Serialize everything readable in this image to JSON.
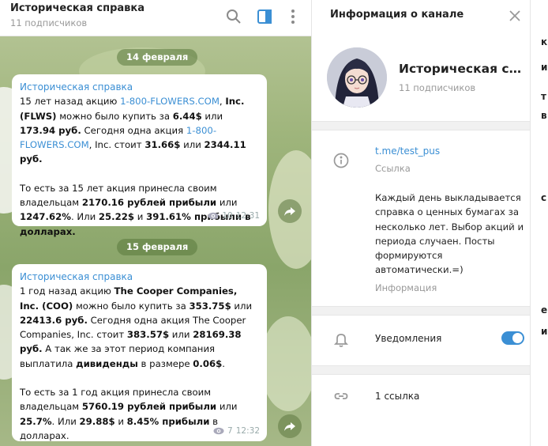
{
  "chat": {
    "title": "Историческая справка",
    "subscribers": "11 подписчиков"
  },
  "dates": [
    "14 февраля",
    "15 февраля"
  ],
  "messages": [
    {
      "author": "Историческая справка",
      "views": "10",
      "time": "12:31",
      "p1": [
        {
          "t": "15 лет назад акцию "
        },
        {
          "t": "1-800-FLOWERS.COM",
          "s": "link"
        },
        {
          "t": ", "
        },
        {
          "t": "Inc. (FLWS)",
          "s": "b"
        },
        {
          "t": " можно было купить за "
        },
        {
          "t": "6.44$",
          "s": "b"
        },
        {
          "t": " или "
        },
        {
          "t": "173.94 руб.",
          "s": "b"
        },
        {
          "t": " Сегодня одна акция "
        },
        {
          "t": "1-800-FLOWERS.COM",
          "s": "link"
        },
        {
          "t": ", Inc. стоит "
        },
        {
          "t": "31.66$",
          "s": "b"
        },
        {
          "t": " или "
        },
        {
          "t": "2344.11 руб.",
          "s": "b"
        }
      ],
      "p2": [
        {
          "t": "То есть за 15 лет акция принесла своим владельцам "
        },
        {
          "t": "2170.16 рублей прибыли",
          "s": "b"
        },
        {
          "t": " или "
        },
        {
          "t": "1247.62%",
          "s": "b"
        },
        {
          "t": ". Или "
        },
        {
          "t": "25.22$",
          "s": "b"
        },
        {
          "t": " и "
        },
        {
          "t": "391.61% прибыли в долларах.",
          "s": "b"
        }
      ]
    },
    {
      "author": "Историческая справка",
      "views": "7",
      "time": "12:32",
      "p1": [
        {
          "t": "1 год назад акцию "
        },
        {
          "t": "The Cooper Companies, Inc. (COO)",
          "s": "b"
        },
        {
          "t": " можно было купить за "
        },
        {
          "t": "353.75$",
          "s": "b"
        },
        {
          "t": " или "
        },
        {
          "t": "22413.6 руб.",
          "s": "b"
        },
        {
          "t": " Сегодня одна акция The Cooper Companies, Inc. стоит "
        },
        {
          "t": "383.57$",
          "s": "b"
        },
        {
          "t": " или "
        },
        {
          "t": "28169.38 руб.",
          "s": "b"
        },
        {
          "t": " А так же за этот период компания выплатила "
        },
        {
          "t": "дивиденды",
          "s": "b"
        },
        {
          "t": " в размере "
        },
        {
          "t": "0.06$",
          "s": "b"
        },
        {
          "t": "."
        }
      ],
      "p2": [
        {
          "t": "То есть за 1 год акция принесла своим владельцам "
        },
        {
          "t": "5760.19 рублей прибыли",
          "s": "b"
        },
        {
          "t": " или "
        },
        {
          "t": "25.7%",
          "s": "b"
        },
        {
          "t": ". Или "
        },
        {
          "t": "29.88$",
          "s": "b"
        },
        {
          "t": " и "
        },
        {
          "t": "8.45% прибыли",
          "s": "b"
        },
        {
          "t": " в долларах."
        }
      ]
    }
  ],
  "info": {
    "header_title": "Информация о канале",
    "channel_name": "Историческая справка",
    "subscribers": "11 подписчиков",
    "link": "t.me/test_pus",
    "link_label": "Ссылка",
    "description": "Каждый день выкладывается справка о ценных бумагах за несколько лет. Выбор акций и периода случаен. Посты формируются автоматически.=)",
    "description_label": "Информация",
    "notifications_label": "Уведомления",
    "notifications_on": true,
    "links_count": "1 ссылка"
  },
  "strip_letters": [
    "к",
    "и",
    "т",
    "в",
    "с",
    "е",
    "и"
  ],
  "colors": {
    "accent": "#3b8fd4",
    "date_pill": "#6f8a4f"
  }
}
